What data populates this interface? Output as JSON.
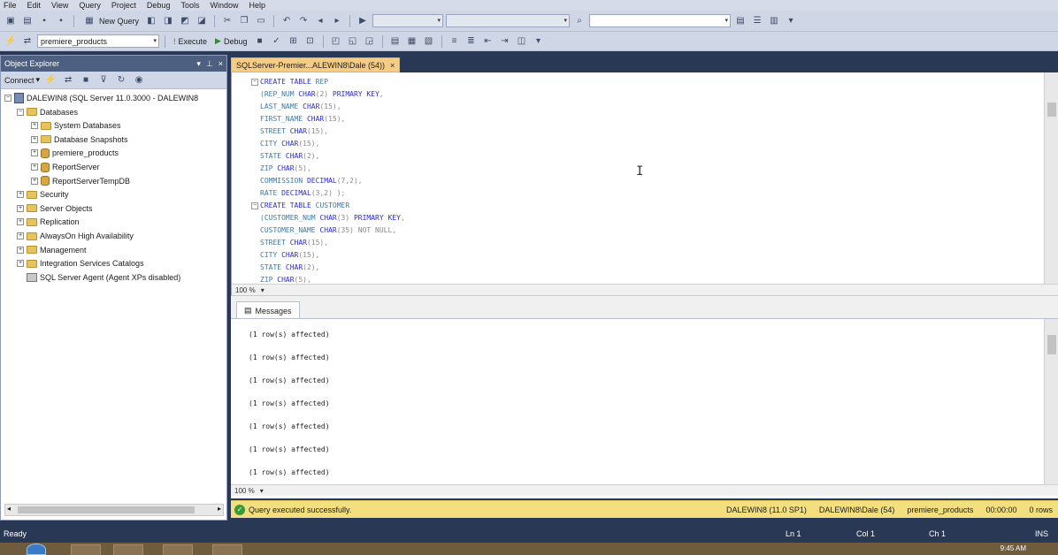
{
  "menu": [
    "File",
    "Edit",
    "View",
    "Query",
    "Project",
    "Debug",
    "Tools",
    "Window",
    "Help"
  ],
  "toolbar": {
    "new_query": "New Query",
    "database_select": "premiere_products",
    "execute": "Execute",
    "debug": "Debug"
  },
  "object_explorer": {
    "title": "Object Explorer",
    "connect": "Connect",
    "tree": [
      {
        "label": "DALEWIN8 (SQL Server 11.0.3000 - DALEWIN8",
        "icon": "server-icon",
        "expanded": true
      },
      {
        "label": "Databases",
        "icon": "folder-icon",
        "expanded": true
      },
      {
        "label": "System Databases",
        "icon": "folder-icon",
        "expanded": false
      },
      {
        "label": "Database Snapshots",
        "icon": "folder-icon",
        "expanded": false
      },
      {
        "label": "premiere_products",
        "icon": "database-icon",
        "expanded": false
      },
      {
        "label": "ReportServer",
        "icon": "database-icon",
        "expanded": false
      },
      {
        "label": "ReportServerTempDB",
        "icon": "database-icon",
        "expanded": false
      },
      {
        "label": "Security",
        "icon": "folder-icon",
        "expanded": false
      },
      {
        "label": "Server Objects",
        "icon": "folder-icon",
        "expanded": false
      },
      {
        "label": "Replication",
        "icon": "folder-icon",
        "expanded": false
      },
      {
        "label": "AlwaysOn High Availability",
        "icon": "folder-icon",
        "expanded": false
      },
      {
        "label": "Management",
        "icon": "folder-icon",
        "expanded": false
      },
      {
        "label": "Integration Services Catalogs",
        "icon": "folder-icon",
        "expanded": false
      },
      {
        "label": "SQL Server Agent (Agent XPs disabled)",
        "icon": "agent-icon",
        "expanded": null
      }
    ]
  },
  "document_tab": {
    "title": "SQLServer-Premier...ALEWIN8\\Dale (54))",
    "close": "×"
  },
  "editor": {
    "lines": [
      [
        {
          "t": "CREATE TABLE ",
          "c": "kw"
        },
        {
          "t": "REP",
          "c": "col"
        }
      ],
      [
        {
          "t": "(REP_NUM ",
          "c": "col"
        },
        {
          "t": "CHAR",
          "c": "kw"
        },
        {
          "t": "(2) ",
          "c": "gray"
        },
        {
          "t": "PRIMARY KEY",
          "c": "kw"
        },
        {
          "t": ",",
          "c": "gray"
        }
      ],
      [
        {
          "t": "LAST_NAME ",
          "c": "col"
        },
        {
          "t": "CHAR",
          "c": "kw"
        },
        {
          "t": "(15),",
          "c": "gray"
        }
      ],
      [
        {
          "t": "FIRST_NAME ",
          "c": "col"
        },
        {
          "t": "CHAR",
          "c": "kw"
        },
        {
          "t": "(15),",
          "c": "gray"
        }
      ],
      [
        {
          "t": "STREET ",
          "c": "col"
        },
        {
          "t": "CHAR",
          "c": "kw"
        },
        {
          "t": "(15),",
          "c": "gray"
        }
      ],
      [
        {
          "t": "CITY ",
          "c": "col"
        },
        {
          "t": "CHAR",
          "c": "kw"
        },
        {
          "t": "(15),",
          "c": "gray"
        }
      ],
      [
        {
          "t": "STATE ",
          "c": "col"
        },
        {
          "t": "CHAR",
          "c": "kw"
        },
        {
          "t": "(2),",
          "c": "gray"
        }
      ],
      [
        {
          "t": "ZIP ",
          "c": "col"
        },
        {
          "t": "CHAR",
          "c": "kw"
        },
        {
          "t": "(5),",
          "c": "gray"
        }
      ],
      [
        {
          "t": "COMMISSION ",
          "c": "col"
        },
        {
          "t": "DECIMAL",
          "c": "kw"
        },
        {
          "t": "(7,2),",
          "c": "gray"
        }
      ],
      [
        {
          "t": "RATE ",
          "c": "col"
        },
        {
          "t": "DECIMAL",
          "c": "kw"
        },
        {
          "t": "(3,2) );",
          "c": "gray"
        }
      ],
      [
        {
          "t": "CREATE TABLE ",
          "c": "kw"
        },
        {
          "t": "CUSTOMER",
          "c": "col"
        }
      ],
      [
        {
          "t": "(CUSTOMER_NUM ",
          "c": "col"
        },
        {
          "t": "CHAR",
          "c": "kw"
        },
        {
          "t": "(3) ",
          "c": "gray"
        },
        {
          "t": "PRIMARY KEY",
          "c": "kw"
        },
        {
          "t": ",",
          "c": "gray"
        }
      ],
      [
        {
          "t": "CUSTOMER_NAME ",
          "c": "col"
        },
        {
          "t": "CHAR",
          "c": "kw"
        },
        {
          "t": "(35) NOT NULL,",
          "c": "gray"
        }
      ],
      [
        {
          "t": "STREET ",
          "c": "col"
        },
        {
          "t": "CHAR",
          "c": "kw"
        },
        {
          "t": "(15),",
          "c": "gray"
        }
      ],
      [
        {
          "t": "CITY ",
          "c": "col"
        },
        {
          "t": "CHAR",
          "c": "kw"
        },
        {
          "t": "(15),",
          "c": "gray"
        }
      ],
      [
        {
          "t": "STATE ",
          "c": "col"
        },
        {
          "t": "CHAR",
          "c": "kw"
        },
        {
          "t": "(2),",
          "c": "gray"
        }
      ],
      [
        {
          "t": "ZIP ",
          "c": "col"
        },
        {
          "t": "CHAR",
          "c": "kw"
        },
        {
          "t": "(5),",
          "c": "gray"
        }
      ]
    ],
    "zoom": "100 %"
  },
  "results": {
    "tab_label": "Messages",
    "messages": [
      "(1 row(s) affected)",
      "(1 row(s) affected)",
      "(1 row(s) affected)",
      "(1 row(s) affected)",
      "(1 row(s) affected)",
      "(1 row(s) affected)",
      "(1 row(s) affected)"
    ],
    "zoom": "100 %"
  },
  "query_status": {
    "message": "Query executed successfully.",
    "server": "DALEWIN8 (11.0 SP1)",
    "user": "DALEWIN8\\Dale (54)",
    "database": "premiere_products",
    "elapsed": "00:00:00",
    "rows": "0 rows"
  },
  "app_status": {
    "state": "Ready",
    "ln": "Ln 1",
    "col": "Col 1",
    "ch": "Ch 1",
    "mode": "INS"
  },
  "taskbar": {
    "clock": "9:45 AM"
  },
  "colors": {
    "chrome": "#293955",
    "accent_tab": "#f5cc84",
    "status_yellow": "#f3df7e",
    "keyword": "#2b2bd6"
  }
}
